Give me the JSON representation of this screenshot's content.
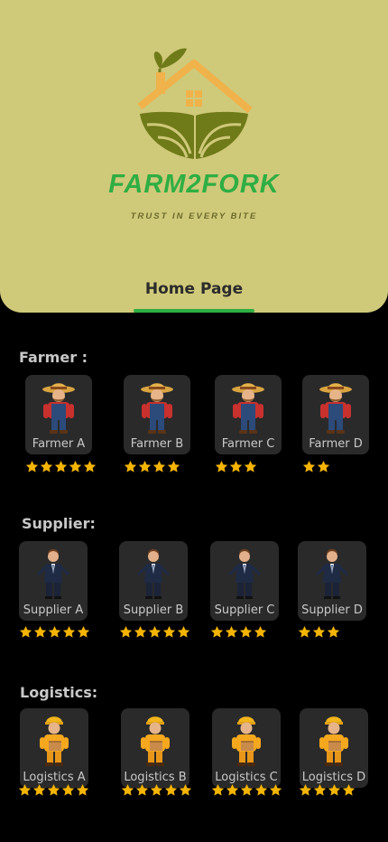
{
  "header": {
    "brand": "FARM2FORK",
    "tagline": "TRUST IN EVERY BITE",
    "tab_label": "Home Page",
    "bg_color": "#cfc97a",
    "accent_color": "#2fae43"
  },
  "sections": [
    {
      "title": "Farmer :",
      "icon": "farmer-icon",
      "items": [
        {
          "label": "Farmer A",
          "rating": 5
        },
        {
          "label": "Farmer B",
          "rating": 4
        },
        {
          "label": "Farmer C",
          "rating": 3
        },
        {
          "label": "Farmer D",
          "rating": 2
        }
      ]
    },
    {
      "title": "Supplier:",
      "icon": "supplier-icon",
      "items": [
        {
          "label": "Supplier A",
          "rating": 5
        },
        {
          "label": "Supplier B",
          "rating": 5
        },
        {
          "label": "Supplier C",
          "rating": 4
        },
        {
          "label": "Supplier D",
          "rating": 3
        }
      ]
    },
    {
      "title": "Logistics:",
      "icon": "logistics-icon",
      "items": [
        {
          "label": "Logistics A",
          "rating": 5
        },
        {
          "label": "Logistics B",
          "rating": 5
        },
        {
          "label": "Logistics C",
          "rating": 5
        },
        {
          "label": "Logistics D",
          "rating": 4
        }
      ]
    }
  ],
  "star_color": "#f5b400"
}
